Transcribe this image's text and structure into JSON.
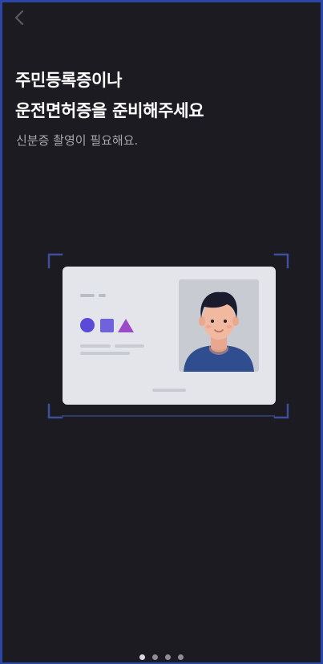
{
  "header": {
    "back_icon": "chevron-left-icon"
  },
  "title": {
    "line1": "주민등록증이나",
    "line2": "운전면허증을 준비해주세요"
  },
  "subtitle": "신분증 촬영이 필요해요.",
  "illustration": {
    "icon": "id-card-illustration-icon",
    "frame_color": "#3d4f9a",
    "card_color": "#e3e5ea",
    "shape_colors": [
      "#5b49d8",
      "#6f63dd",
      "#9b4bc8"
    ]
  },
  "pager": {
    "total": 4,
    "active_index": 0
  }
}
